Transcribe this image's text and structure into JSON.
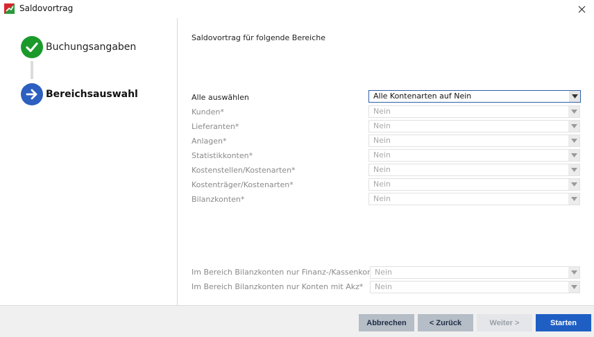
{
  "window": {
    "title": "Saldovortrag"
  },
  "steps": [
    {
      "label": "Buchungsangaben",
      "state": "done",
      "icon": "checkmark-icon"
    },
    {
      "label": "Bereichsauswahl",
      "state": "active",
      "icon": "arrow-right-icon"
    }
  ],
  "content": {
    "section_title": "Saldovortrag für folgende Bereiche",
    "select_all": {
      "label": "Alle auswählen",
      "value": "Alle Kontenarten auf Nein"
    },
    "areas": [
      {
        "label": "Kunden*",
        "value": "Nein"
      },
      {
        "label": "Lieferanten*",
        "value": "Nein"
      },
      {
        "label": "Anlagen*",
        "value": "Nein"
      },
      {
        "label": "Statistikkonten*",
        "value": "Nein"
      },
      {
        "label": "Kostenstellen/Kostenarten*",
        "value": "Nein"
      },
      {
        "label": "Kostenträger/Kostenarten*",
        "value": "Nein"
      },
      {
        "label": "Bilanzkonten*",
        "value": "Nein"
      }
    ],
    "balance_options": [
      {
        "label": "Im Bereich Bilanzkonten nur Finanz-/Kassenkonten*",
        "value": "Nein"
      },
      {
        "label": "Im Bereich Bilanzkonten nur Konten mit Akz*",
        "value": "Nein"
      }
    ]
  },
  "footer": {
    "cancel_label": "Abbrechen",
    "back_label": "< Zurück",
    "next_label": "Weiter >",
    "start_label": "Starten"
  },
  "colors": {
    "done": "#1a9a2a",
    "active": "#2c5fc0",
    "primary_button": "#1f5fc4",
    "secondary_button": "#b5bdc7"
  }
}
